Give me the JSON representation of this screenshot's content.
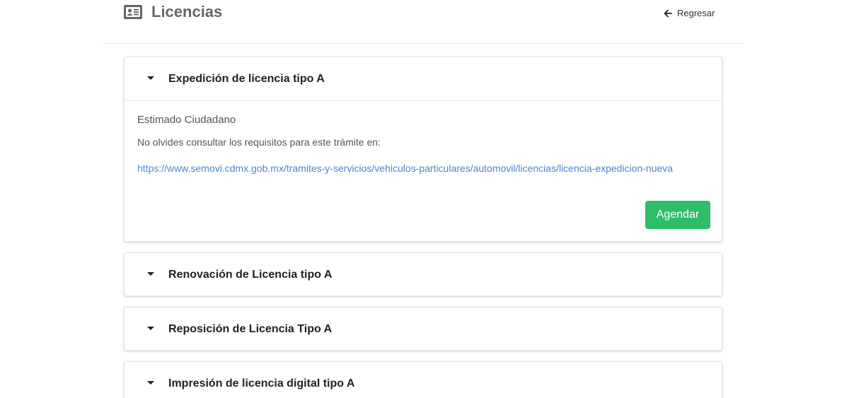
{
  "header": {
    "title": "Licencias",
    "icon": "id-card-icon",
    "back_label": "Regresar",
    "back_icon": "arrow-left-icon"
  },
  "panels": [
    {
      "title": "Expedición de licencia tipo A",
      "expanded": true,
      "greeting": "Estimado Ciudadano",
      "text": "No olvides consultar los requisitos para este trámite en:",
      "link": "https://www.semovi.cdmx.gob.mx/tramites-y-servicios/vehiculos-particulares/automovil/licencias/licencia-expedicion-nueva",
      "button_label": "Agendar"
    },
    {
      "title": "Renovación de Licencia tipo A",
      "expanded": false
    },
    {
      "title": "Reposición de Licencia Tipo A",
      "expanded": false
    },
    {
      "title": "Impresión de licencia digital tipo A",
      "expanded": false
    }
  ],
  "colors": {
    "accent_button": "#2ebd6b",
    "link": "#4a86c8",
    "title_gray": "#666666"
  }
}
